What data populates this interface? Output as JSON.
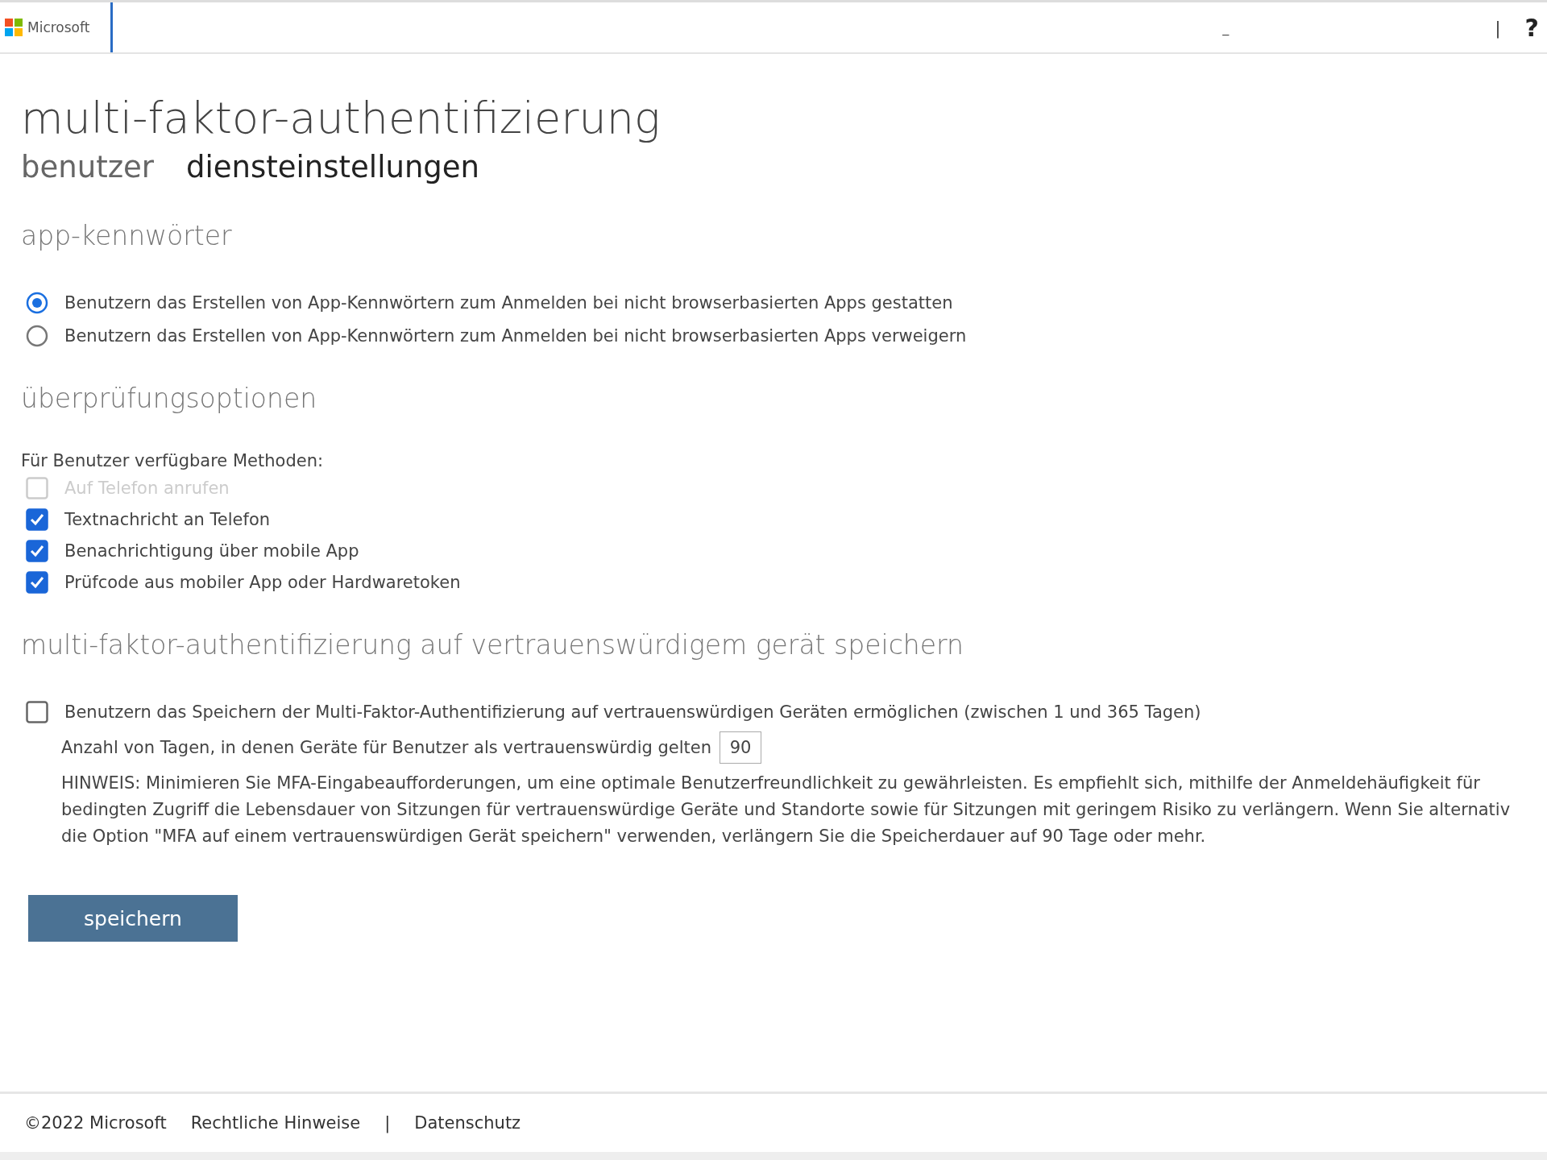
{
  "header": {
    "brand": "Microsoft",
    "marks": [
      {
        "text": "_",
        "kind": "minor"
      },
      {
        "text": "|",
        "kind": "minor"
      },
      {
        "text": "?",
        "kind": "help"
      }
    ]
  },
  "title": "multi-faktor-authentifizierung",
  "tabs": [
    {
      "label": "benutzer",
      "selected": false
    },
    {
      "label": "diensteinstellungen",
      "selected": true
    }
  ],
  "app_passwords": {
    "heading": "app-kennwörter",
    "options": [
      {
        "label": "Benutzern das Erstellen von App-Kennwörtern zum Anmelden bei nicht browserbasierten Apps gestatten",
        "selected": true
      },
      {
        "label": "Benutzern das Erstellen von App-Kennwörtern zum Anmelden bei nicht browserbasierten Apps verweigern",
        "selected": false
      }
    ]
  },
  "verification": {
    "heading": "überprüfungsoptionen",
    "label": "Für Benutzer verfügbare Methoden:",
    "methods": [
      {
        "label": "Auf Telefon anrufen",
        "checked": false,
        "disabled": true
      },
      {
        "label": "Textnachricht an Telefon",
        "checked": true,
        "disabled": false
      },
      {
        "label": "Benachrichtigung über mobile App",
        "checked": true,
        "disabled": false
      },
      {
        "label": "Prüfcode aus mobiler App oder Hardwaretoken",
        "checked": true,
        "disabled": false
      }
    ]
  },
  "remember": {
    "heading": "multi-faktor-authentifizierung auf vertrauenswürdigem gerät speichern",
    "option": {
      "label": "Benutzern das Speichern der Multi-Faktor-Authentifizierung auf vertrauenswürdigen Geräten ermöglichen (zwischen 1 und 365 Tagen)",
      "checked": false
    },
    "days_label": "Anzahl von Tagen, in denen Geräte für Benutzer als vertrauenswürdig gelten",
    "days_value": "90",
    "note": "HINWEIS: Minimieren Sie MFA-Eingabeaufforderungen, um eine optimale Benutzerfreundlichkeit zu gewährleisten. Es empfiehlt sich, mithilfe der Anmeldehäufigkeit für bedingten Zugriff die Lebensdauer von Sitzungen für vertrauenswürdige Geräte und Standorte sowie für Sitzungen mit geringem Risiko zu verlängern. Wenn Sie alternativ die Option \"MFA auf einem vertrauenswürdigen Gerät speichern\" verwenden, verlängern Sie die Speicherdauer auf 90 Tage oder mehr."
  },
  "save_button": "speichern",
  "footer": {
    "copyright": "©2022 Microsoft",
    "links": [
      "Rechtliche Hinweise",
      "Datenschutz"
    ],
    "separator": "|"
  }
}
